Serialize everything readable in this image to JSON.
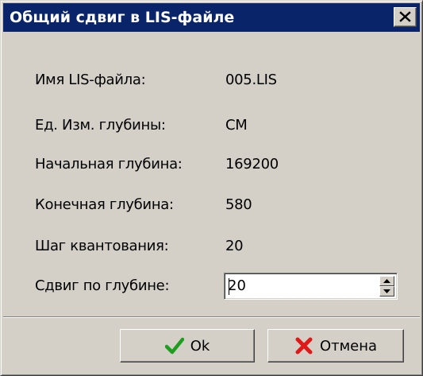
{
  "window": {
    "title": "Общий сдвиг в LIS-файле"
  },
  "fields": [
    {
      "label": "Имя LIS-файла:",
      "value": "005.LIS"
    },
    {
      "label": "Ед. Изм. глубины:",
      "value": "CM"
    },
    {
      "label": "Начальная глубина:",
      "value": "169200"
    },
    {
      "label": "Конечная глубина:",
      "value": "580"
    },
    {
      "label": "Шаг квантования:",
      "value": "20"
    }
  ],
  "shift": {
    "label": "Сдвиг по глубине:",
    "value": "20"
  },
  "buttons": {
    "ok_label": "Ok",
    "ok_icon": "checkmark-icon",
    "cancel_label": "Отмена",
    "cancel_icon": "red-x-icon"
  },
  "colors": {
    "titlebar": "#0a246a",
    "dialog_bg": "#d4d0c8",
    "ok_icon": "#1e9e1e",
    "cancel_icon": "#e01818"
  }
}
